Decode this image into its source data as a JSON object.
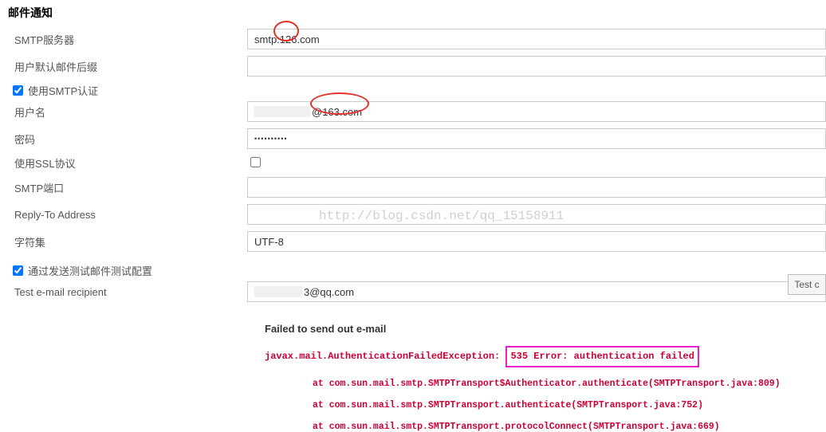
{
  "section_title": "邮件通知",
  "labels": {
    "smtp_server": "SMTP服务器",
    "default_suffix": "用户默认邮件后缀",
    "use_smtp_auth": "使用SMTP认证",
    "username": "用户名",
    "password": "密码",
    "use_ssl": "使用SSL协议",
    "smtp_port": "SMTP端口",
    "reply_to": "Reply-To Address",
    "charset": "字符集",
    "test_config": "通过发送测试邮件测试配置",
    "test_recipient": "Test e-mail recipient"
  },
  "values": {
    "smtp_server": "smtp.126.com",
    "default_suffix": "",
    "username_suffix": "@163.com",
    "password": "••••••••••",
    "smtp_port": "",
    "reply_to": "",
    "charset": "UTF-8",
    "test_recipient_suffix": "3@qq.com"
  },
  "button": {
    "test": "Test c"
  },
  "error": {
    "title": "Failed to send out e-mail",
    "exception_prefix": "javax.mail.AuthenticationFailedException: ",
    "exception_detail": "535 Error: authentication failed",
    "stack": [
      "at com.sun.mail.smtp.SMTPTransport$Authenticator.authenticate(SMTPTransport.java:809)",
      "at com.sun.mail.smtp.SMTPTransport.authenticate(SMTPTransport.java:752)",
      "at com.sun.mail.smtp.SMTPTransport.protocolConnect(SMTPTransport.java:669)"
    ]
  },
  "watermark": "http://blog.csdn.net/qq_15158911"
}
